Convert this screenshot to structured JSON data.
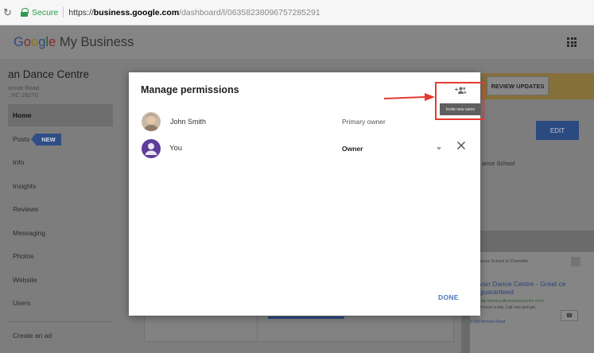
{
  "browser": {
    "secure_label": "Secure",
    "url_scheme": "https://",
    "url_host": "business.google.com",
    "url_path": "/dashboard/l/06358238096757285291"
  },
  "app": {
    "logo_google": [
      "G",
      "o",
      "o",
      "g",
      "l",
      "e"
    ],
    "logo_suffix": "My Business"
  },
  "business": {
    "name": "an Dance Centre",
    "address_line1": "onroe Road",
    "address_line2": ", NC 28270"
  },
  "sidebar": {
    "items": [
      {
        "label": "Home",
        "active": true
      },
      {
        "label": "Posts",
        "badge": "NEW"
      },
      {
        "label": "Info"
      },
      {
        "label": "Insights"
      },
      {
        "label": "Reviews"
      },
      {
        "label": "Messaging"
      },
      {
        "label": "Photos"
      },
      {
        "label": "Website"
      },
      {
        "label": "Users"
      }
    ],
    "create_ad": "Create an ad"
  },
  "background": {
    "review_updates": "REVIEW UPDATES",
    "edit": "EDIT",
    "category_fragment": "ance School",
    "phone": {
      "search_text": "Dance School in Charlotte",
      "ad_title": "van Dance Centre - Great ce guaranteed",
      "ad_url": "http://www.sullivandancecentre.com/",
      "ad_desc": "4 hours a day. Call now and get",
      "ad_addr": "9 NW Monroe Road"
    }
  },
  "modal": {
    "title": "Manage permissions",
    "users": [
      {
        "name": "John Smith",
        "role": "Primary owner",
        "avatar": "photo"
      },
      {
        "name": "You",
        "role": "Owner",
        "avatar": "default"
      }
    ],
    "done_label": "DONE",
    "invite_tooltip": "Invite new users"
  },
  "colors": {
    "accent_blue": "#4a77c4",
    "annotation_red": "#e53a2f",
    "you_avatar": "#5e3c99"
  },
  "icons": {
    "invite": "add-people-icon",
    "remove": "close-icon",
    "apps": "apps-grid-icon",
    "lock": "lock-icon"
  }
}
